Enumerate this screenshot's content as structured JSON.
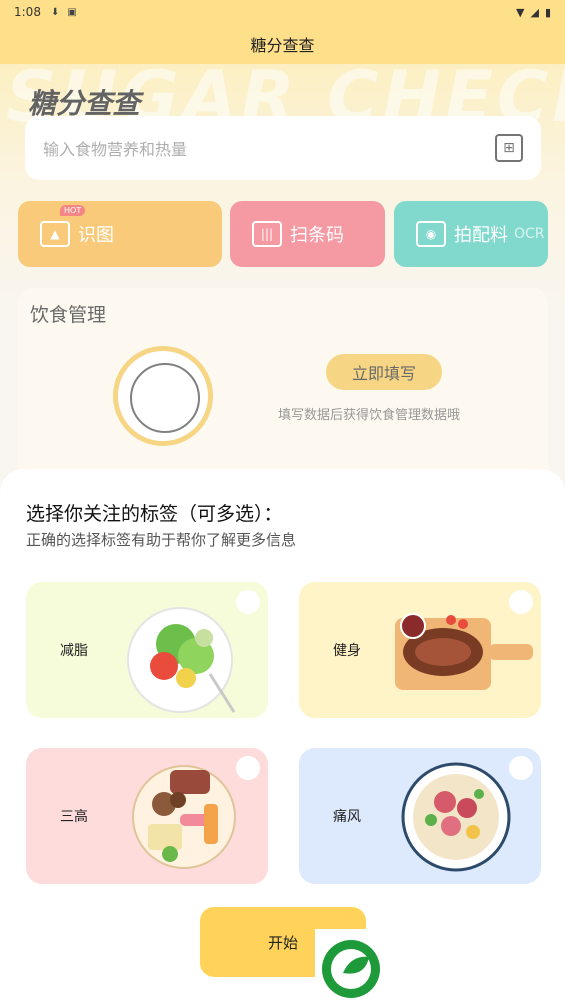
{
  "status_bar": {
    "time": "1:08",
    "download_icon": "download-icon",
    "notification_icon": "app-notification-icon",
    "wifi_icon": "wifi-icon",
    "signal_icon": "signal-icon",
    "battery_icon": "battery-icon"
  },
  "app_bar": {
    "title": "糖分查查"
  },
  "background": {
    "watermark": "SUGAR CHECK",
    "app_title": "糖分查查",
    "search": {
      "placeholder": "输入食物营养和热量",
      "scan_icon": "scan-icon"
    },
    "feature_buttons": [
      {
        "label": "识图",
        "icon": "image-icon",
        "badge": "HOT",
        "color": "#f7b23c"
      },
      {
        "label": "扫条码",
        "icon": "barcode-icon",
        "color": "#f06a78"
      },
      {
        "label": "拍配料",
        "icon": "camera-icon",
        "extra": "OCR",
        "color": "#46c6b6"
      }
    ],
    "diet_management": {
      "title": "饮食管理",
      "button": "立即填写",
      "hint": "填写数据后获得饮食管理数据哦"
    }
  },
  "sheet": {
    "title": "选择你关注的标签（可多选）：",
    "subtitle": "正确的选择标签有助于帮你了解更多信息",
    "tags": [
      {
        "label": "减脂",
        "color": "#f6fbd9",
        "image": "salad-plate",
        "selected": false
      },
      {
        "label": "健身",
        "color": "#fff3c8",
        "image": "steak-board",
        "selected": false
      },
      {
        "label": "三高",
        "color": "#ffdcdc",
        "image": "mixed-platter",
        "selected": false
      },
      {
        "label": "痛风",
        "color": "#dde9fd",
        "image": "noodle-bowl",
        "selected": false
      }
    ],
    "start_button": "开始"
  }
}
